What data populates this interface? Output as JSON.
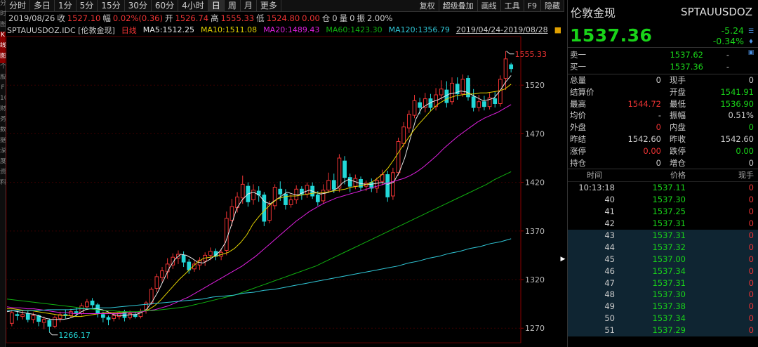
{
  "left_tabs": [
    "分",
    "时",
    "图",
    "K",
    "线",
    "图",
    "个",
    "股",
    "F",
    "10",
    "财",
    "务",
    "数",
    "据",
    "深",
    "度",
    "资",
    "料"
  ],
  "toolbar": {
    "items": [
      "分时",
      "多日",
      "1分",
      "5分",
      "15分",
      "30分",
      "60分",
      "4小时",
      "日",
      "周",
      "月",
      "更多"
    ],
    "active": "日",
    "right": [
      "复权",
      "超级叠加",
      "画线",
      "工具",
      "F9",
      "隐藏"
    ]
  },
  "quote": {
    "date": "2019/08/26",
    "close_label": "收",
    "close": "1527.10",
    "amp_label": "幅",
    "amp": "0.02%(0.36)",
    "open_label": "开",
    "open": "1526.74",
    "high_label": "高",
    "high": "1555.33",
    "low_label": "低",
    "low": "1524.80",
    "amount": "0.00",
    "pos_label": "仓",
    "pos": "0",
    "vol_label": "量",
    "vol": "0",
    "swing_label": "振",
    "swing": "2.00%"
  },
  "ma_bar": {
    "symbol": "SPTAUUSDOZ.IDC",
    "name": "[伦敦金现]",
    "period": "日线",
    "ma5": "MA5:1512.25",
    "ma10": "MA10:1511.08",
    "ma20": "MA20:1489.43",
    "ma60": "MA60:1423.30",
    "ma120": "MA120:1356.79",
    "range": "2019/04/24-2019/08/28"
  },
  "colors": {
    "up": "#e33",
    "down": "#23d8d8",
    "ma5": "#e8e8e8",
    "ma10": "#e0d000",
    "ma20": "#e020e0",
    "ma60": "#10b010",
    "ma120": "#30c8d8",
    "grid": "#3a0000"
  },
  "chart_data": {
    "type": "candlestick",
    "symbol": "SPTAUUSDOZ.IDC",
    "period": "日线",
    "x_range": [
      "2019/04/24",
      "2019/08/28"
    ],
    "ylim": [
      1255,
      1570
    ],
    "yticks": [
      1270,
      1320,
      1370,
      1420,
      1470,
      1520
    ],
    "annotations": {
      "high": "1555.33",
      "low": "1266.17"
    },
    "candles": [
      [
        1275,
        1286,
        1272,
        1289
      ],
      [
        1284,
        1283,
        1278,
        1288
      ],
      [
        1282,
        1284,
        1279,
        1288
      ],
      [
        1285,
        1279,
        1276,
        1288
      ],
      [
        1279,
        1283,
        1275,
        1286
      ],
      [
        1283,
        1277,
        1272,
        1284
      ],
      [
        1276,
        1279,
        1269,
        1282
      ],
      [
        1278,
        1272,
        1266,
        1280
      ],
      [
        1272,
        1281,
        1270,
        1283
      ],
      [
        1280,
        1284,
        1276,
        1287
      ],
      [
        1284,
        1283,
        1280,
        1289
      ],
      [
        1283,
        1287,
        1281,
        1290
      ],
      [
        1287,
        1286,
        1282,
        1291
      ],
      [
        1285,
        1293,
        1283,
        1296
      ],
      [
        1292,
        1297,
        1289,
        1300
      ],
      [
        1298,
        1294,
        1291,
        1301
      ],
      [
        1294,
        1285,
        1281,
        1296
      ],
      [
        1284,
        1281,
        1276,
        1287
      ],
      [
        1281,
        1279,
        1273,
        1283
      ],
      [
        1280,
        1283,
        1277,
        1286
      ],
      [
        1282,
        1286,
        1279,
        1288
      ],
      [
        1287,
        1281,
        1277,
        1289
      ],
      [
        1281,
        1285,
        1279,
        1288
      ],
      [
        1284,
        1282,
        1280,
        1287
      ],
      [
        1282,
        1287,
        1280,
        1290
      ],
      [
        1288,
        1296,
        1285,
        1298
      ],
      [
        1296,
        1310,
        1294,
        1312
      ],
      [
        1311,
        1323,
        1307,
        1326
      ],
      [
        1322,
        1329,
        1318,
        1333
      ],
      [
        1328,
        1336,
        1321,
        1342
      ],
      [
        1335,
        1343,
        1331,
        1347
      ],
      [
        1342,
        1346,
        1336,
        1350
      ],
      [
        1345,
        1338,
        1333,
        1349
      ],
      [
        1338,
        1330,
        1326,
        1341
      ],
      [
        1331,
        1336,
        1328,
        1339
      ],
      [
        1335,
        1340,
        1330,
        1343
      ],
      [
        1339,
        1345,
        1334,
        1348
      ],
      [
        1345,
        1349,
        1340,
        1353
      ],
      [
        1349,
        1344,
        1340,
        1352
      ],
      [
        1344,
        1348,
        1340,
        1351
      ],
      [
        1350,
        1383,
        1345,
        1390
      ],
      [
        1381,
        1395,
        1375,
        1403
      ],
      [
        1394,
        1405,
        1389,
        1410
      ],
      [
        1404,
        1418,
        1398,
        1427
      ],
      [
        1416,
        1400,
        1395,
        1420
      ],
      [
        1402,
        1412,
        1397,
        1418
      ],
      [
        1411,
        1407,
        1400,
        1416
      ],
      [
        1407,
        1380,
        1375,
        1410
      ],
      [
        1381,
        1397,
        1378,
        1401
      ],
      [
        1396,
        1415,
        1392,
        1418
      ],
      [
        1413,
        1408,
        1401,
        1421
      ],
      [
        1408,
        1397,
        1392,
        1413
      ],
      [
        1397,
        1402,
        1394,
        1408
      ],
      [
        1402,
        1413,
        1398,
        1417
      ],
      [
        1413,
        1408,
        1402,
        1416
      ],
      [
        1408,
        1417,
        1404,
        1420
      ],
      [
        1416,
        1406,
        1403,
        1420
      ],
      [
        1407,
        1400,
        1396,
        1411
      ],
      [
        1401,
        1412,
        1398,
        1418
      ],
      [
        1412,
        1422,
        1409,
        1430
      ],
      [
        1422,
        1413,
        1409,
        1429
      ],
      [
        1414,
        1445,
        1410,
        1449
      ],
      [
        1442,
        1425,
        1418,
        1447
      ],
      [
        1425,
        1416,
        1410,
        1429
      ],
      [
        1416,
        1424,
        1413,
        1428
      ],
      [
        1423,
        1415,
        1411,
        1426
      ],
      [
        1416,
        1419,
        1411,
        1422
      ],
      [
        1420,
        1414,
        1410,
        1424
      ],
      [
        1414,
        1422,
        1409,
        1425
      ],
      [
        1421,
        1428,
        1417,
        1433
      ],
      [
        1428,
        1405,
        1400,
        1432
      ],
      [
        1406,
        1430,
        1402,
        1435
      ],
      [
        1430,
        1462,
        1427,
        1466
      ],
      [
        1460,
        1477,
        1456,
        1482
      ],
      [
        1476,
        1490,
        1471,
        1494
      ],
      [
        1489,
        1504,
        1486,
        1510
      ],
      [
        1502,
        1497,
        1490,
        1507
      ],
      [
        1497,
        1506,
        1492,
        1512
      ],
      [
        1506,
        1497,
        1493,
        1511
      ],
      [
        1498,
        1510,
        1494,
        1517
      ],
      [
        1510,
        1516,
        1505,
        1525
      ],
      [
        1515,
        1502,
        1497,
        1524
      ],
      [
        1503,
        1522,
        1500,
        1528
      ],
      [
        1521,
        1511,
        1505,
        1528
      ],
      [
        1511,
        1526,
        1508,
        1531
      ],
      [
        1527,
        1508,
        1504,
        1530
      ],
      [
        1508,
        1497,
        1493,
        1516
      ],
      [
        1497,
        1503,
        1493,
        1510
      ],
      [
        1503,
        1498,
        1494,
        1509
      ],
      [
        1498,
        1507,
        1495,
        1512
      ],
      [
        1506,
        1501,
        1497,
        1513
      ],
      [
        1501,
        1526,
        1498,
        1530
      ],
      [
        1527,
        1547,
        1515,
        1555
      ],
      [
        1541,
        1537,
        1533,
        1543
      ]
    ],
    "ma_series": [
      {
        "name": "MA5",
        "values": [
          1287,
          1288,
          1287,
          1286,
          1285,
          1284,
          1282,
          1280,
          1279,
          1279,
          1279,
          1280,
          1282,
          1286,
          1289,
          1290,
          1290,
          1289,
          1287,
          1284,
          1283,
          1283,
          1284,
          1284,
          1286,
          1290,
          1298,
          1308,
          1320,
          1332,
          1341,
          1346,
          1345,
          1342,
          1338,
          1337,
          1340,
          1344,
          1349,
          1358,
          1375,
          1393,
          1402,
          1408,
          1410,
          1407,
          1400,
          1398,
          1402,
          1406,
          1410,
          1408,
          1407,
          1410,
          1412,
          1410,
          1408,
          1409,
          1411,
          1414,
          1420,
          1423,
          1421,
          1419,
          1418,
          1418,
          1419,
          1420,
          1418,
          1420,
          1430,
          1445,
          1465,
          1485,
          1496,
          1500,
          1503,
          1505,
          1508,
          1511,
          1512,
          1514,
          1513,
          1510,
          1507,
          1504,
          1505,
          1507,
          1514,
          1523,
          1530
        ]
      },
      {
        "name": "MA10",
        "values": [
          1290,
          1290,
          1289,
          1288,
          1288,
          1287,
          1286,
          1285,
          1284,
          1283,
          1283,
          1282,
          1282,
          1283,
          1284,
          1285,
          1286,
          1286,
          1286,
          1286,
          1286,
          1286,
          1287,
          1289,
          1293,
          1299,
          1306,
          1313,
          1320,
          1326,
          1332,
          1338,
          1342,
          1343,
          1344,
          1346,
          1348,
          1352,
          1358,
          1366,
          1377,
          1385,
          1392,
          1398,
          1403,
          1405,
          1406,
          1406,
          1407,
          1408,
          1409,
          1409,
          1410,
          1411,
          1412,
          1413,
          1415,
          1416,
          1417,
          1419,
          1423,
          1428,
          1435,
          1444,
          1454,
          1463,
          1472,
          1480,
          1487,
          1494,
          1500,
          1504,
          1507,
          1509,
          1510,
          1511,
          1511,
          1512,
          1512,
          1513,
          1514,
          1516,
          1521
        ]
      },
      {
        "name": "MA20",
        "values": [
          1292,
          1291,
          1291,
          1290,
          1290,
          1289,
          1288,
          1287,
          1286,
          1286,
          1285,
          1285,
          1285,
          1285,
          1285,
          1285,
          1285,
          1285,
          1286,
          1286,
          1287,
          1288,
          1289,
          1291,
          1293,
          1296,
          1299,
          1302,
          1306,
          1310,
          1314,
          1318,
          1322,
          1326,
          1330,
          1334,
          1339,
          1344,
          1350,
          1356,
          1362,
          1368,
          1374,
          1380,
          1385,
          1390,
          1394,
          1398,
          1401,
          1404,
          1406,
          1408,
          1410,
          1412,
          1414,
          1416,
          1418,
          1420,
          1422,
          1424,
          1427,
          1431,
          1436,
          1442,
          1448,
          1455,
          1461,
          1467,
          1472,
          1477,
          1482,
          1486,
          1489,
          1492,
          1496,
          1500
        ]
      },
      {
        "name": "MA60",
        "values": [
          1300,
          1299,
          1298,
          1297,
          1296,
          1295,
          1294,
          1293,
          1292,
          1291,
          1290,
          1289,
          1288,
          1288,
          1287,
          1287,
          1287,
          1288,
          1288,
          1289,
          1290,
          1291,
          1292,
          1294,
          1296,
          1298,
          1300,
          1302,
          1304,
          1307,
          1310,
          1313,
          1316,
          1319,
          1322,
          1325,
          1328,
          1331,
          1334,
          1338,
          1342,
          1346,
          1350,
          1354,
          1358,
          1362,
          1366,
          1370,
          1374,
          1378,
          1382,
          1386,
          1390,
          1394,
          1398,
          1402,
          1406,
          1410,
          1414,
          1418,
          1423,
          1427,
          1431
        ]
      },
      {
        "name": "MA120",
        "values": [
          1288,
          1288,
          1288,
          1288,
          1289,
          1289,
          1289,
          1290,
          1290,
          1291,
          1291,
          1292,
          1293,
          1294,
          1295,
          1296,
          1297,
          1298,
          1299,
          1300,
          1302,
          1303,
          1304,
          1306,
          1307,
          1309,
          1310,
          1312,
          1314,
          1316,
          1318,
          1320,
          1322,
          1324,
          1326,
          1328,
          1330,
          1332,
          1334,
          1337,
          1339,
          1342,
          1344,
          1347,
          1349,
          1352,
          1354,
          1357,
          1359,
          1362
        ]
      }
    ]
  },
  "panel": {
    "name": "伦敦金现",
    "code": "SPTAUUSDOZ",
    "price": "1537.36",
    "change": "-5.24",
    "change_pct": "-0.34%",
    "orders": [
      {
        "label": "卖一",
        "price": "1537.62",
        "vol": "-"
      },
      {
        "label": "买一",
        "price": "1537.36",
        "vol": "-"
      }
    ],
    "stats": [
      {
        "l1": "总量",
        "v1": "0",
        "c1": "nu",
        "l2": "现手",
        "v2": "0",
        "c2": "nu"
      },
      {
        "l1": "结算价",
        "v1": "",
        "c1": "nu",
        "l2": "开盘",
        "v2": "1541.91",
        "c2": "dn"
      },
      {
        "l1": "最高",
        "v1": "1544.72",
        "c1": "up",
        "l2": "最低",
        "v2": "1536.90",
        "c2": "dn"
      },
      {
        "l1": "均价",
        "v1": "-",
        "c1": "nu",
        "l2": "振幅",
        "v2": "0.51%",
        "c2": "nu"
      },
      {
        "l1": "外盘",
        "v1": "0",
        "c1": "up",
        "l2": "内盘",
        "v2": "0",
        "c2": "dn"
      },
      {
        "l1": "昨结",
        "v1": "1542.60",
        "c1": "nu",
        "l2": "昨收",
        "v2": "1542.60",
        "c2": "nu"
      },
      {
        "l1": "涨停",
        "v1": "0.00",
        "c1": "up",
        "l2": "跌停",
        "v2": "0.00",
        "c2": "dn"
      },
      {
        "l1": "持仓",
        "v1": "0",
        "c1": "nu",
        "l2": "增仓",
        "v2": "0",
        "c2": "nu"
      }
    ],
    "trades_header": {
      "time": "时间",
      "price": "价格",
      "vol": "现手"
    },
    "trades": [
      {
        "time": "10:13:18",
        "price": "1537.11",
        "vol": "0"
      },
      {
        "time": "40",
        "price": "1537.30",
        "vol": "0"
      },
      {
        "time": "41",
        "price": "1537.25",
        "vol": "0"
      },
      {
        "time": "42",
        "price": "1537.31",
        "vol": "0"
      },
      {
        "time": "43",
        "price": "1537.31",
        "vol": "0"
      },
      {
        "time": "44",
        "price": "1537.32",
        "vol": "0"
      },
      {
        "time": "45",
        "price": "1537.00",
        "vol": "0"
      },
      {
        "time": "46",
        "price": "1537.34",
        "vol": "0"
      },
      {
        "time": "47",
        "price": "1537.31",
        "vol": "0"
      },
      {
        "time": "48",
        "price": "1537.30",
        "vol": "0"
      },
      {
        "time": "49",
        "price": "1537.38",
        "vol": "0"
      },
      {
        "time": "50",
        "price": "1537.34",
        "vol": "0"
      },
      {
        "time": "51",
        "price": "1537.29",
        "vol": "0"
      }
    ]
  }
}
